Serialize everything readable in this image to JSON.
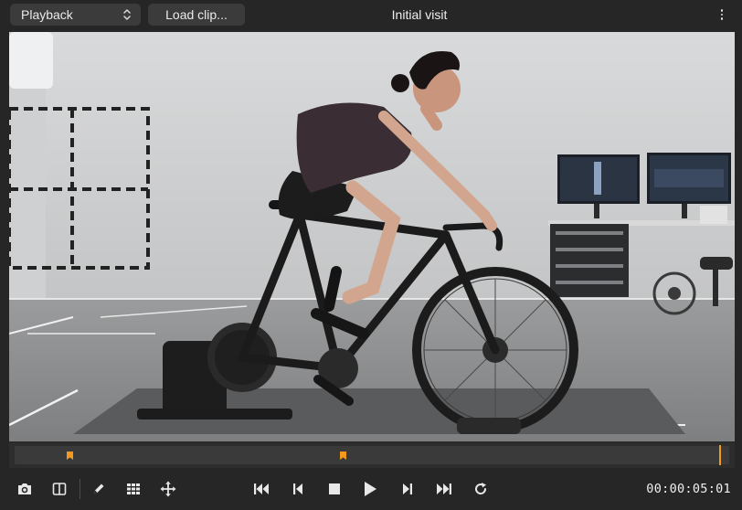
{
  "toolbar": {
    "mode_select": {
      "value": "Playback"
    },
    "load_button": "Load clip...",
    "title": "Initial visit",
    "more_icon": "more-vertical-icon"
  },
  "viewport": {
    "content": "video-frame",
    "subject": "cyclist on indoor bike trainer in motion-capture lab"
  },
  "timeline": {
    "markers": [
      0.077,
      0.46
    ],
    "playhead": 0.987,
    "colors": {
      "marker": "#f39a1e",
      "playhead": "#f39a1e"
    }
  },
  "controls": {
    "left_tools": [
      "camera-icon",
      "split-view-icon",
      "pencil-icon",
      "grid-icon",
      "move-icon"
    ],
    "transport": [
      "skip-to-start-icon",
      "step-back-icon",
      "stop-icon",
      "play-icon",
      "step-forward-icon",
      "skip-to-end-icon",
      "loop-icon"
    ],
    "timecode": "00:00:05:01"
  }
}
